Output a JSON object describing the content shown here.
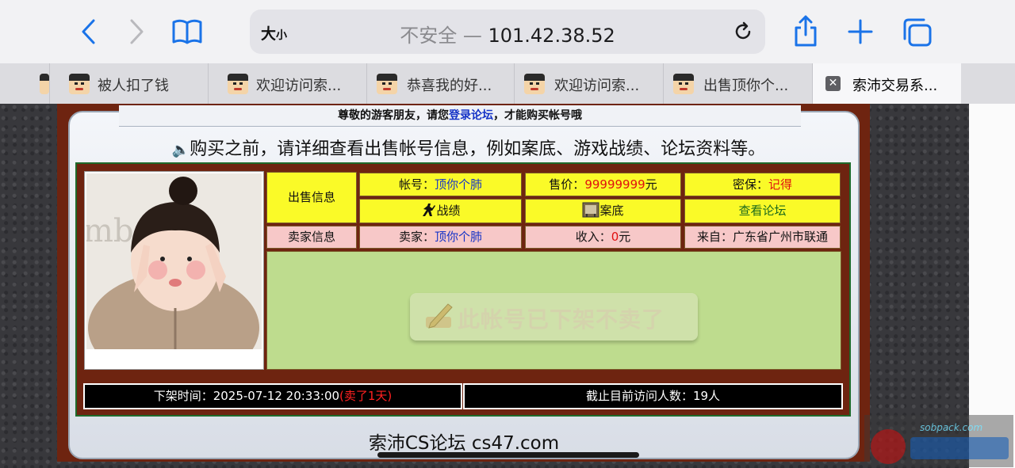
{
  "browser": {
    "reader_label": "大",
    "reader_label_small": "小",
    "url_insecure": "不安全 — ",
    "url_host": "101.42.38.52"
  },
  "tabs": [
    {
      "label": "被人扣了钱"
    },
    {
      "label": "欢迎访问索..."
    },
    {
      "label": "恭喜我的好..."
    },
    {
      "label": "欢迎访问索..."
    },
    {
      "label": "出售顶你个..."
    },
    {
      "label": "索沛交易系..."
    }
  ],
  "page": {
    "notice_pre": "尊敬的游客朋友，请您",
    "notice_link": "登录论坛",
    "notice_post": "，才能购买帐号哦",
    "headline": "购买之前，请详细查看出售帐号信息，例如案底、游戏战绩、论坛资料等。",
    "sale_info_label": "出售信息",
    "account_label": "帐号：",
    "account_value": "顶你个肺",
    "price_label": "售价：",
    "price_value": "99999999",
    "price_unit": "元",
    "security_label": "密保：",
    "security_value": "记得",
    "record_label": "战绩",
    "case_label": "案底",
    "forum_link": "查看论坛",
    "seller_info_label": "卖家信息",
    "seller_label": "卖家：",
    "seller_value": "顶你个肺",
    "income_label": "收入：",
    "income_value": "0",
    "income_unit": "元",
    "from_label": "来自：",
    "from_value": "广东省广州市联通",
    "status_stamp": "此帐号已下架不卖了",
    "delist_time_label": "下架时间：",
    "delist_time": "2025-07-12 20:33:00",
    "delist_note": "(卖了1天)",
    "visitors_label": "截止目前访问人数：",
    "visitors_value": "19",
    "visitors_unit": "人",
    "footer": "索沛CS论坛 cs47.com",
    "photo_text": "mb"
  },
  "watermark_text": "sobpack.com"
}
